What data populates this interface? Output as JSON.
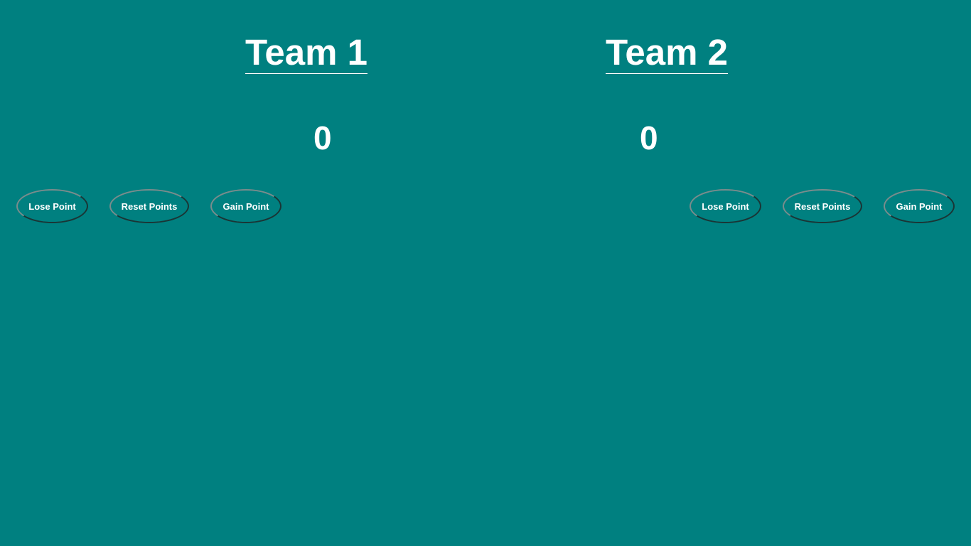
{
  "teams": [
    {
      "name": "Team 1",
      "score": "0",
      "buttons": {
        "lose": "Lose Point",
        "reset": "Reset Points",
        "gain": "Gain Point"
      }
    },
    {
      "name": "Team 2",
      "score": "0",
      "buttons": {
        "lose": "Lose Point",
        "reset": "Reset Points",
        "gain": "Gain Point"
      }
    }
  ],
  "colors": {
    "background": "#008080",
    "text": "#ffffff"
  }
}
